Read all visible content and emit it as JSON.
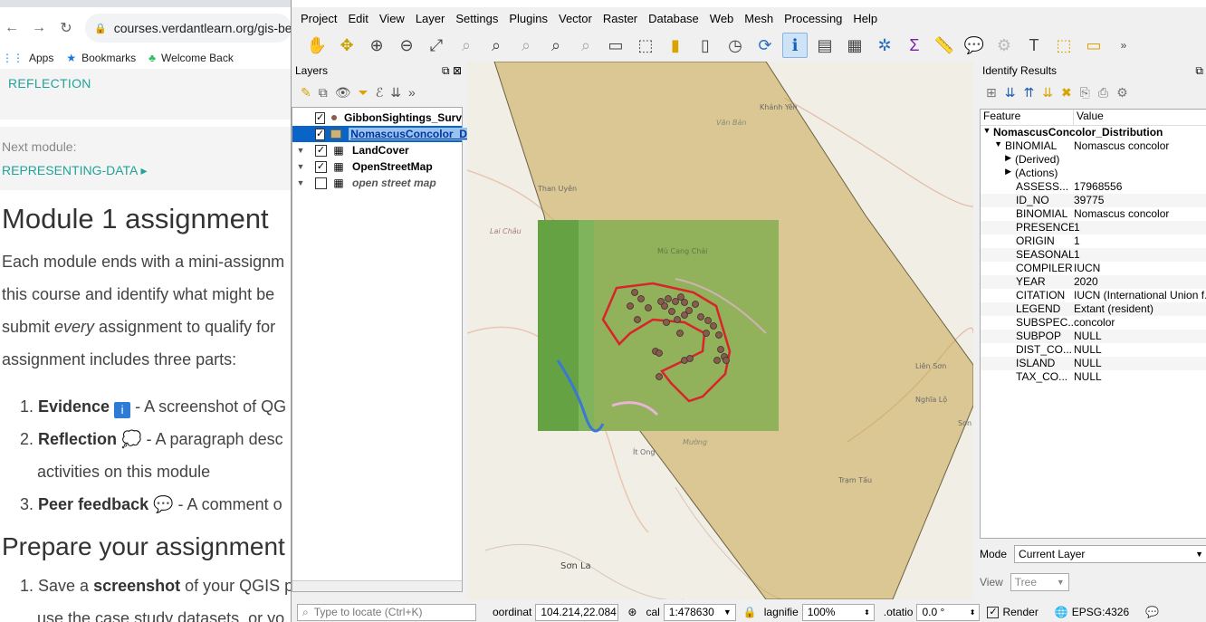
{
  "browser": {
    "url": "courses.verdantlearn.org/gis-be",
    "bookmarks": [
      "Apps",
      "Bookmarks",
      "Welcome Back"
    ],
    "reflection_link": "REFLECTION",
    "next_label": "Next module:",
    "next_link": "REPRESENTING-DATA",
    "heading": "Module 1 assignment",
    "para1": "Each module ends with a mini-assignm",
    "para2": "this course and identify what might be",
    "para3_pre": "submit ",
    "para3_em": "every",
    "para3_post": " assignment to qualify for",
    "para4": "assignment includes three parts:",
    "list": [
      {
        "num": "1.",
        "title": "Evidence",
        "rest": " - A screenshot of QG"
      },
      {
        "num": "2.",
        "title": "Reflection",
        "rest": " - A paragraph desc"
      },
      {
        "num": "",
        "title": "",
        "rest": "activities on this module"
      },
      {
        "num": "3.",
        "title": "Peer feedback",
        "rest": " - A comment o"
      }
    ],
    "heading2": "Prepare your assignment",
    "list2_num": "1.",
    "list2_pre": "Save a ",
    "list2_bold": "screenshot",
    "list2_post": " of your QGIS p",
    "list2_line2": "use the case study datasets, or yo"
  },
  "qgis": {
    "menu": [
      "Project",
      "Edit",
      "View",
      "Layer",
      "Settings",
      "Plugins",
      "Vector",
      "Raster",
      "Database",
      "Web",
      "Mesh",
      "Processing",
      "Help"
    ],
    "layers_title": "Layers",
    "layers": [
      {
        "name": "GibbonSightings_Surv",
        "checked": "✓",
        "type": "point",
        "selected": false,
        "italic": false
      },
      {
        "name": "NomascusConcolor_Di",
        "checked": "✓",
        "type": "polygon",
        "selected": true,
        "italic": false
      },
      {
        "name": "LandCover",
        "checked": "✓",
        "type": "raster",
        "selected": false,
        "italic": false
      },
      {
        "name": "OpenStreetMap",
        "checked": "✓",
        "type": "raster",
        "selected": false,
        "italic": false
      },
      {
        "name": "open street map",
        "checked": "",
        "type": "raster",
        "selected": false,
        "italic": true
      }
    ],
    "map_labels": [
      "Khánh Yên",
      "Văn Bàn",
      "Than Uyên",
      "Mù Cang Chải",
      "Lai Châu",
      "Ít Ong",
      "Liên Sơn",
      "Nghĩa Lộ",
      "Trạm Tấu",
      "Sơn La",
      "Sơn",
      "Mường"
    ],
    "identify": {
      "title": "Identify Results",
      "col_feature": "Feature",
      "col_value": "Value",
      "layer_name": "NomascusConcolor_Distribution",
      "binomial_key": "BINOMIAL",
      "binomial_value": "Nomascus concolor",
      "derived": "(Derived)",
      "actions": "(Actions)",
      "attributes": [
        [
          "ASSESS...",
          "17968556"
        ],
        [
          "ID_NO",
          "39775"
        ],
        [
          "BINOMIAL",
          "Nomascus concolor"
        ],
        [
          "PRESENCE",
          "1"
        ],
        [
          "ORIGIN",
          "1"
        ],
        [
          "SEASONAL",
          "1"
        ],
        [
          "COMPILER",
          "IUCN"
        ],
        [
          "YEAR",
          "2020"
        ],
        [
          "CITATION",
          "IUCN (International Union f..."
        ],
        [
          "LEGEND",
          "Extant (resident)"
        ],
        [
          "SUBSPEC...",
          "concolor"
        ],
        [
          "SUBPOP",
          "NULL"
        ],
        [
          "DIST_CO...",
          "NULL"
        ],
        [
          "ISLAND",
          "NULL"
        ],
        [
          "TAX_CO...",
          "NULL"
        ]
      ],
      "mode_label": "Mode",
      "mode_value": "Current Layer",
      "view_label": "View",
      "view_value": "Tree"
    },
    "status": {
      "locate_placeholder": "Type to locate (Ctrl+K)",
      "coord_label": "oordinat",
      "coord_value": "104.214,22.084",
      "scale_label": "cal",
      "scale_value": "1:478630",
      "magnifier_label": "lagnifie",
      "magnifier_value": "100%",
      "rotation_label": ".otatio",
      "rotation_value": "0.0 °",
      "render_label": "Render",
      "crs": "EPSG:4326"
    }
  }
}
